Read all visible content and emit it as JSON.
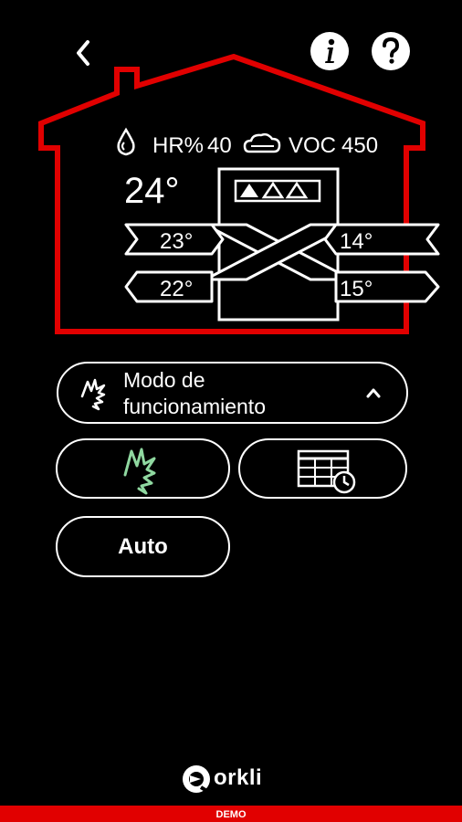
{
  "header": {
    "back_icon": "chevron-left-icon",
    "info_icon": "info-icon",
    "help_icon": "question-icon"
  },
  "house": {
    "humidity_icon": "drop-icon",
    "humidity_label": "HR%",
    "humidity_value": "40",
    "voc_icon": "cloud-icon",
    "voc_label": "VOC",
    "voc_value": "450",
    "indoor_temp": "24°",
    "fan_level_icon": "fan-level-icon",
    "flows": {
      "left_top": "23°",
      "left_bottom": "22°",
      "right_top": "14°",
      "right_bottom": "15°"
    },
    "outline_color": "#e10000"
  },
  "controls": {
    "mode_selector": {
      "icon": "manual-mode-icon",
      "label_line1": "Modo de",
      "label_line2": "funcionamiento",
      "chevron": "chevron-up-icon"
    },
    "manual_button": {
      "icon": "manual-mode-icon",
      "accent": "#8fd8a0"
    },
    "schedule_button": {
      "icon": "calendar-clock-icon"
    },
    "auto_button": {
      "label": "Auto"
    }
  },
  "footer": {
    "logo_text": "orkli",
    "demo_label": "DEMO",
    "bar_color": "#e10000"
  }
}
